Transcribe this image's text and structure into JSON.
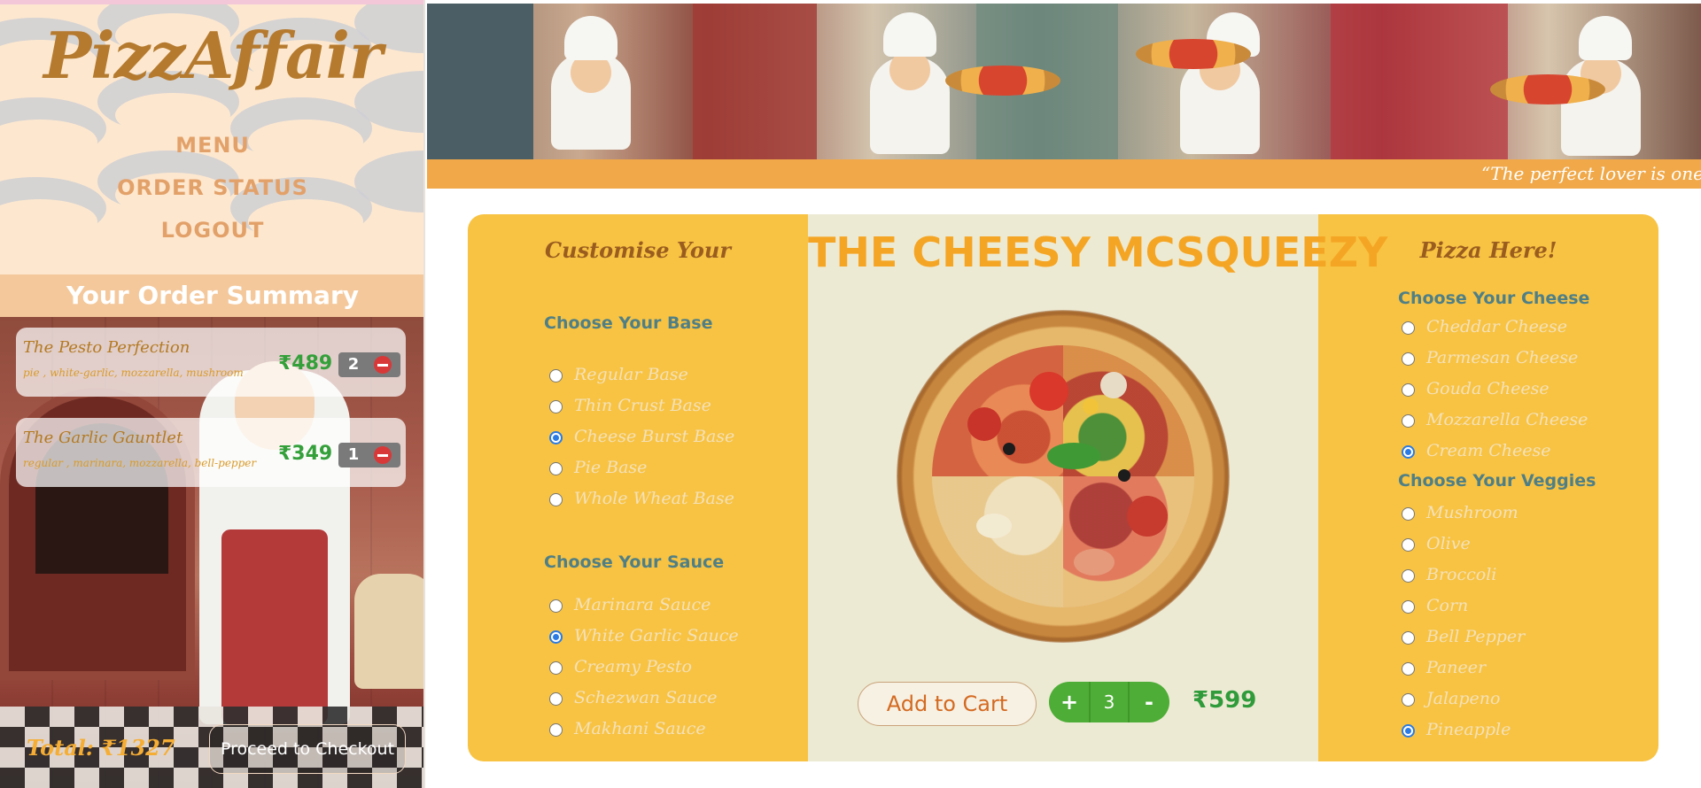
{
  "brand": {
    "logo": "PizzAffair"
  },
  "nav": {
    "menu": "MENU",
    "order_status": "ORDER STATUS",
    "logout": "LOGOUT"
  },
  "summary": {
    "title": "Your Order Summary",
    "items": [
      {
        "name": "The Pesto Perfection",
        "desc": "pie , white-garlic, mozzarella, mushroom",
        "price": "₹489",
        "qty": "2"
      },
      {
        "name": "The Garlic Gauntlet",
        "desc": "regular , marinara, mozzarella, bell-pepper",
        "price": "₹349",
        "qty": "1"
      }
    ],
    "total": "Total: ₹1327",
    "checkout": "Proceed to Checkout"
  },
  "banner": {
    "quote": "“The perfect lover is one w"
  },
  "builder": {
    "heading_left": "Customise Your",
    "heading_right": "Pizza Here!",
    "pizza_name": "THE CHEESY MCSQUEEZY",
    "base": {
      "title": "Choose Your Base",
      "options": [
        {
          "label": "Regular Base",
          "selected": false
        },
        {
          "label": "Thin Crust Base",
          "selected": false
        },
        {
          "label": "Cheese Burst Base",
          "selected": true
        },
        {
          "label": "Pie Base",
          "selected": false
        },
        {
          "label": "Whole Wheat Base",
          "selected": false
        }
      ]
    },
    "sauce": {
      "title": "Choose Your Sauce",
      "options": [
        {
          "label": "Marinara Sauce",
          "selected": false
        },
        {
          "label": "White Garlic Sauce",
          "selected": true
        },
        {
          "label": "Creamy Pesto",
          "selected": false
        },
        {
          "label": "Schezwan Sauce",
          "selected": false
        },
        {
          "label": "Makhani Sauce",
          "selected": false
        }
      ]
    },
    "cheese": {
      "title": "Choose Your Cheese",
      "options": [
        {
          "label": "Cheddar Cheese",
          "selected": false
        },
        {
          "label": "Parmesan Cheese",
          "selected": false
        },
        {
          "label": "Gouda Cheese",
          "selected": false
        },
        {
          "label": "Mozzarella Cheese",
          "selected": false
        },
        {
          "label": "Cream Cheese",
          "selected": true
        }
      ]
    },
    "veggies": {
      "title": "Choose Your Veggies",
      "options": [
        {
          "label": "Mushroom",
          "selected": false
        },
        {
          "label": "Olive",
          "selected": false
        },
        {
          "label": "Broccoli",
          "selected": false
        },
        {
          "label": "Corn",
          "selected": false
        },
        {
          "label": "Bell Pepper",
          "selected": false
        },
        {
          "label": "Paneer",
          "selected": false
        },
        {
          "label": "Jalapeno",
          "selected": false
        },
        {
          "label": "Pineapple",
          "selected": true
        }
      ]
    },
    "add_to_cart": "Add to Cart",
    "stepper": {
      "plus": "+",
      "value": "3",
      "minus": "-"
    },
    "price": "₹599"
  },
  "colors": {
    "card": "#f8c342",
    "center_panel": "#edead3",
    "accent_orange": "#f5a524",
    "price_green": "#2f9b3a",
    "group_title": "#4f7f86",
    "radio_selected": "#2a7be4"
  }
}
